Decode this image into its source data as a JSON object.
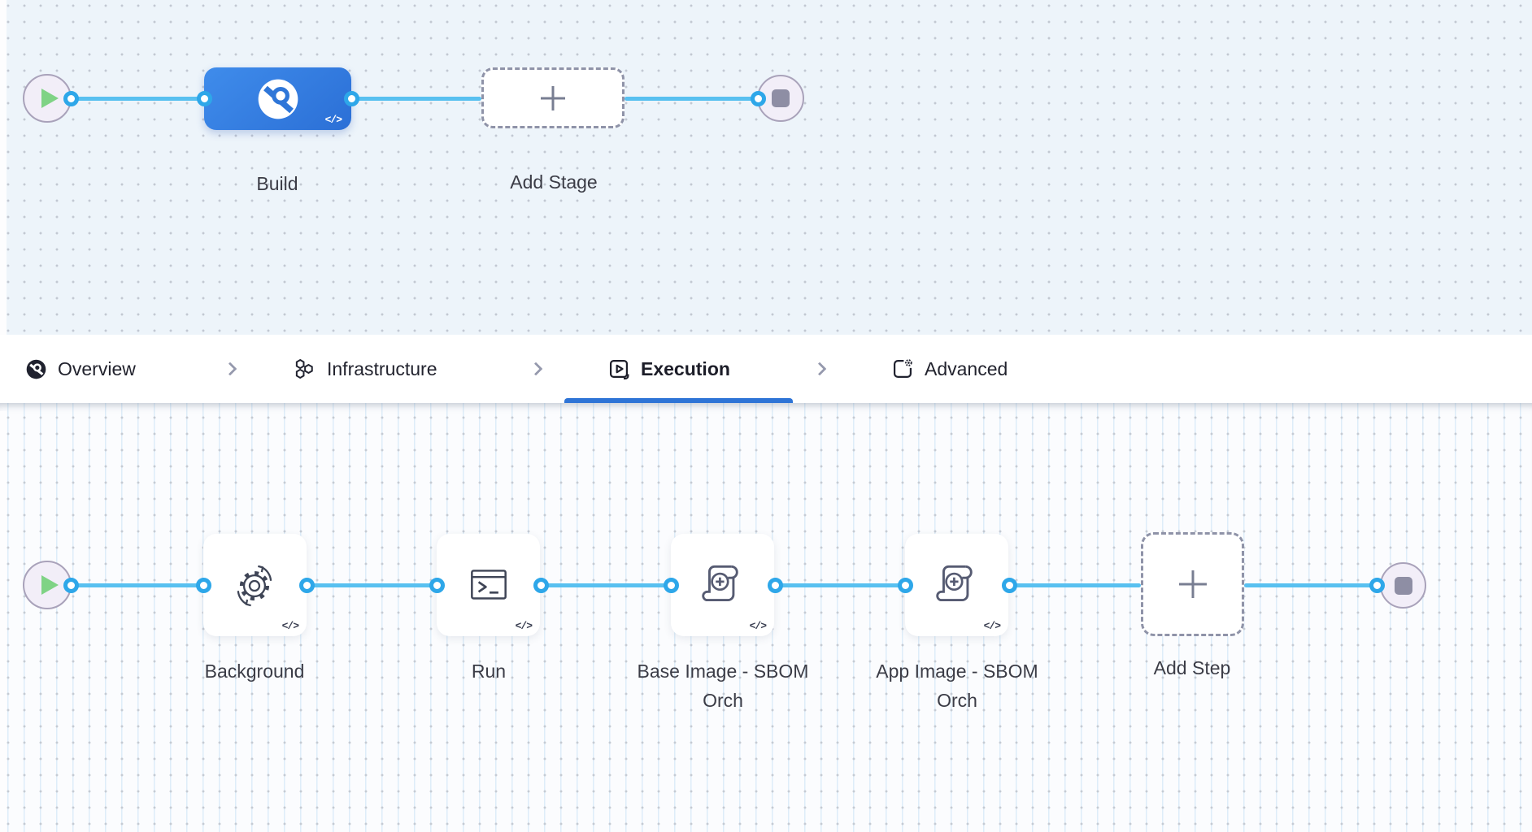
{
  "stage_canvas": {
    "stage": {
      "name": "Build",
      "icon": "harness-ci-disc-icon",
      "code_badge": "</>"
    },
    "add_stage": {
      "label": "Add Stage",
      "icon": "plus-icon"
    },
    "start_node_icon": "play-icon",
    "end_node_icon": "stop-icon"
  },
  "tab_bar": {
    "tabs": [
      {
        "label": "Overview",
        "icon": "ci-overview-icon",
        "active": false
      },
      {
        "label": "Infrastructure",
        "icon": "hexagon-cluster-icon",
        "active": false
      },
      {
        "label": "Execution",
        "icon": "play-square-icon",
        "active": true
      },
      {
        "label": "Advanced",
        "icon": "gear-square-icon",
        "active": false
      }
    ],
    "separator_icon": "chevron-right-icon"
  },
  "execution_canvas": {
    "steps": [
      {
        "name": "Background",
        "icon": "sync-gear-icon",
        "code_badge": "</>"
      },
      {
        "name": "Run",
        "icon": "terminal-icon",
        "code_badge": "</>"
      },
      {
        "name": "Base Image - SBOM Orch",
        "icon": "sbom-scroll-icon",
        "code_badge": "</>"
      },
      {
        "name": "App Image - SBOM Orch",
        "icon": "sbom-scroll-icon",
        "code_badge": "</>"
      }
    ],
    "add_step": {
      "label": "Add Step",
      "icon": "plus-icon"
    },
    "start_node_icon": "play-icon",
    "end_node_icon": "stop-icon"
  },
  "colors": {
    "edge_blue": "#58c0f0",
    "port_ring_blue": "#2ea7e9",
    "stage_gradient_start": "#3f8ceb",
    "stage_gradient_end": "#2b6fd6",
    "active_tab_underline": "#2e74d6",
    "play_green": "#7fd385",
    "stop_gray": "#8e8ea4",
    "canvas_top_bg": "#edf4fa",
    "canvas_bottom_bg": "#fbfcfe",
    "icon_stroke": "#3f4556"
  }
}
